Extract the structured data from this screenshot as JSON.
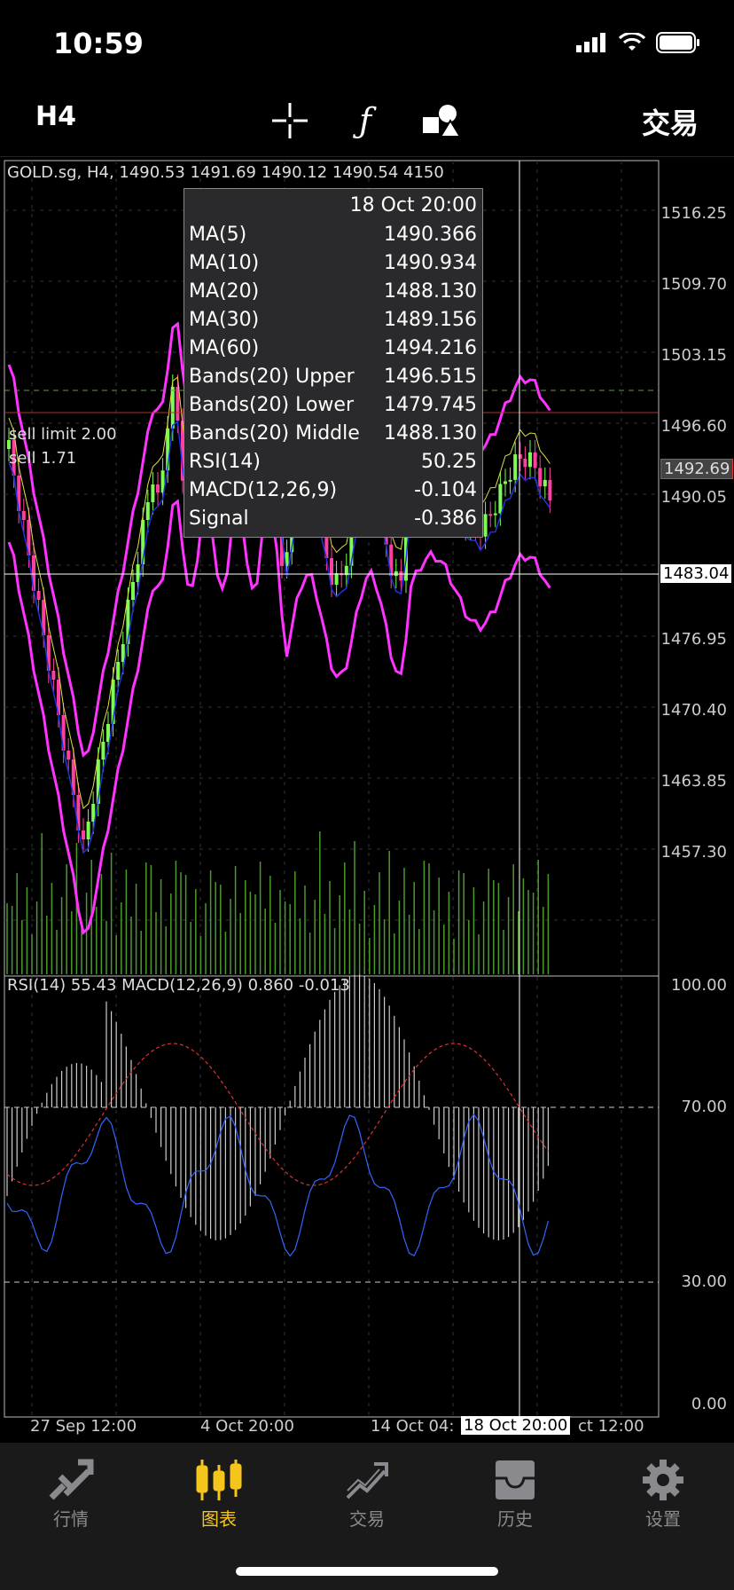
{
  "status": {
    "time": "10:59"
  },
  "toolbar": {
    "timeframe": "H4",
    "trade_label": "交易",
    "icons": [
      "crosshair-icon",
      "function-icon",
      "shapes-icon"
    ]
  },
  "chart": {
    "header": "GOLD.sg, H4, 1490.53 1491.69 1490.12 1490.54 4150",
    "orders": {
      "sell_limit": "sell limit 2.00",
      "sell": "sell 1.71"
    },
    "price_labels": [
      "1516.25",
      "1509.70",
      "1503.15",
      "1496.60",
      "1490.05",
      "1476.95",
      "1470.40",
      "1463.85",
      "1457.30"
    ],
    "current_price": "1492.69",
    "cursor_price": "1483.04",
    "indicator_header": "RSI(14) 55.43 MACD(12,26,9) 0.860 -0.013",
    "indicator_labels": [
      "100.00",
      "70.00",
      "30.00",
      "0.00"
    ],
    "time_labels": [
      "27 Sep 12:00",
      "4 Oct 20:00",
      "14 Oct 04:",
      "ct 12:00"
    ],
    "cursor_time": "18 Oct 20:00",
    "colors": {
      "up": "#7CFC55",
      "down": "#FF3FA0",
      "bands": "#FF33FF",
      "ma_blue": "#2233DD",
      "ma_yellow": "#E0E040",
      "rsi": "#3366FF",
      "macd_signal": "#E03030"
    }
  },
  "info": {
    "date": "18 Oct 20:00",
    "rows": [
      {
        "k": "MA(5)",
        "v": "1490.366"
      },
      {
        "k": "MA(10)",
        "v": "1490.934"
      },
      {
        "k": "MA(20)",
        "v": "1488.130"
      },
      {
        "k": "MA(30)",
        "v": "1489.156"
      },
      {
        "k": "MA(60)",
        "v": "1494.216"
      },
      {
        "k": "Bands(20) Upper",
        "v": "1496.515"
      },
      {
        "k": "Bands(20) Lower",
        "v": "1479.745"
      },
      {
        "k": "Bands(20) Middle",
        "v": "1488.130"
      },
      {
        "k": "RSI(14)",
        "v": "50.25"
      },
      {
        "k": "MACD(12,26,9)",
        "v": "-0.104"
      },
      {
        "k": "Signal",
        "v": "-0.386"
      }
    ]
  },
  "tabs": [
    {
      "label": "行情",
      "icon": "quotes-icon"
    },
    {
      "label": "图表",
      "icon": "chart-icon",
      "active": true
    },
    {
      "label": "交易",
      "icon": "trade-icon"
    },
    {
      "label": "历史",
      "icon": "history-icon"
    },
    {
      "label": "设置",
      "icon": "settings-icon"
    }
  ]
}
